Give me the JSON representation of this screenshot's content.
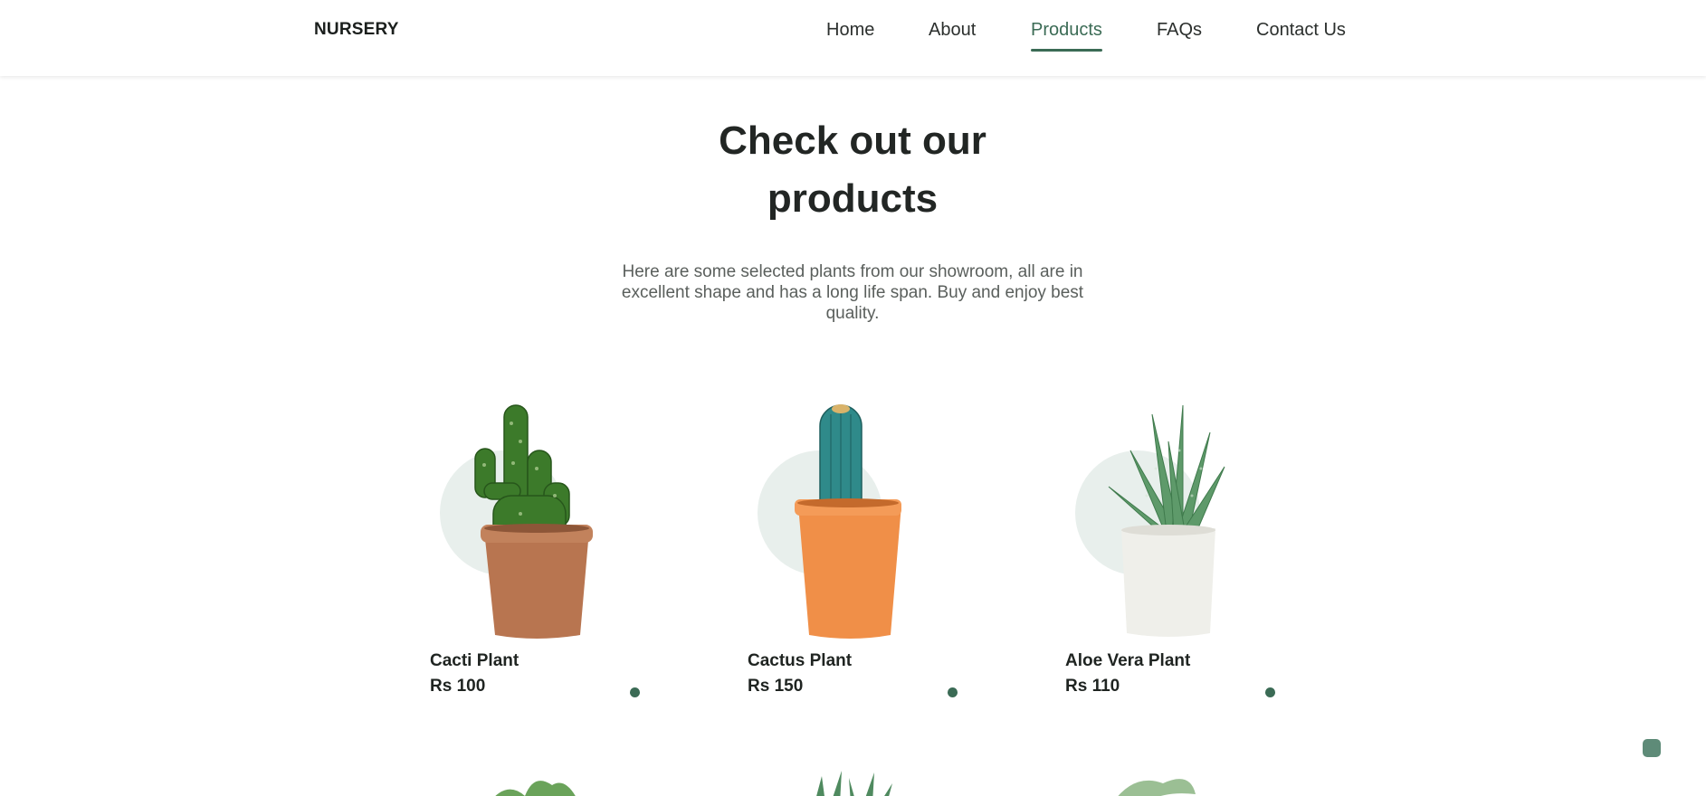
{
  "header": {
    "logo": "NURSERY",
    "nav": [
      {
        "label": "Home",
        "active": false
      },
      {
        "label": "About",
        "active": false
      },
      {
        "label": "Products",
        "active": true
      },
      {
        "label": "FAQs",
        "active": false
      },
      {
        "label": "Contact Us",
        "active": false
      }
    ]
  },
  "hero": {
    "title_line1": "Check out our",
    "title_line2": "products",
    "description": "Here are some selected plants from our showroom, all are in excellent shape and has a long life span. Buy and enjoy best quality."
  },
  "products": [
    {
      "name": "Cacti Plant",
      "price": "Rs 100",
      "icon": "cactus-brown-pot-icon"
    },
    {
      "name": "Cactus Plant",
      "price": "Rs 150",
      "icon": "cactus-orange-pot-icon"
    },
    {
      "name": "Aloe Vera Plant",
      "price": "Rs 110",
      "icon": "aloe-white-pot-icon"
    }
  ],
  "colors": {
    "accent": "#3b6b55",
    "circle": "#e8efec",
    "float_button": "#5e8b78"
  }
}
